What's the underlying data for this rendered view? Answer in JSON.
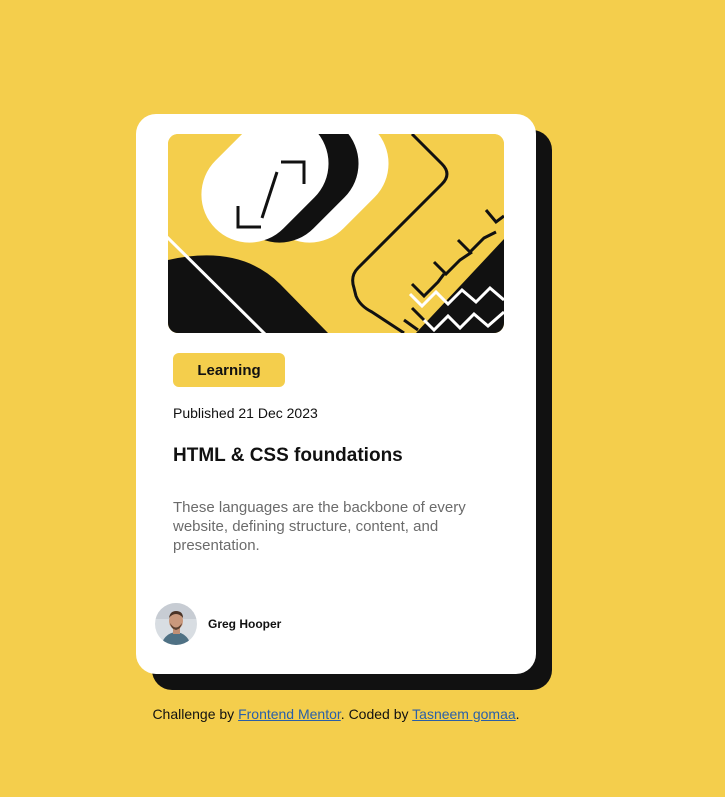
{
  "card": {
    "category": "Learning",
    "published": "Published 21 Dec 2023",
    "title": "HTML & CSS foundations",
    "description": "These languages are the backbone of every website, defining structure, content, and presentation.",
    "author": {
      "name": "Greg Hooper"
    }
  },
  "attribution": {
    "prefix": "Challenge by",
    "challenge_link": "Frontend Mentor",
    "middle": ". Coded by",
    "author_link": "Tasneem gomaa",
    "suffix": "."
  },
  "colors": {
    "background": "#f4ce4c",
    "card": "#ffffff",
    "text": "#111111",
    "muted": "#6b6b6b",
    "link": "#2a5fa8"
  }
}
